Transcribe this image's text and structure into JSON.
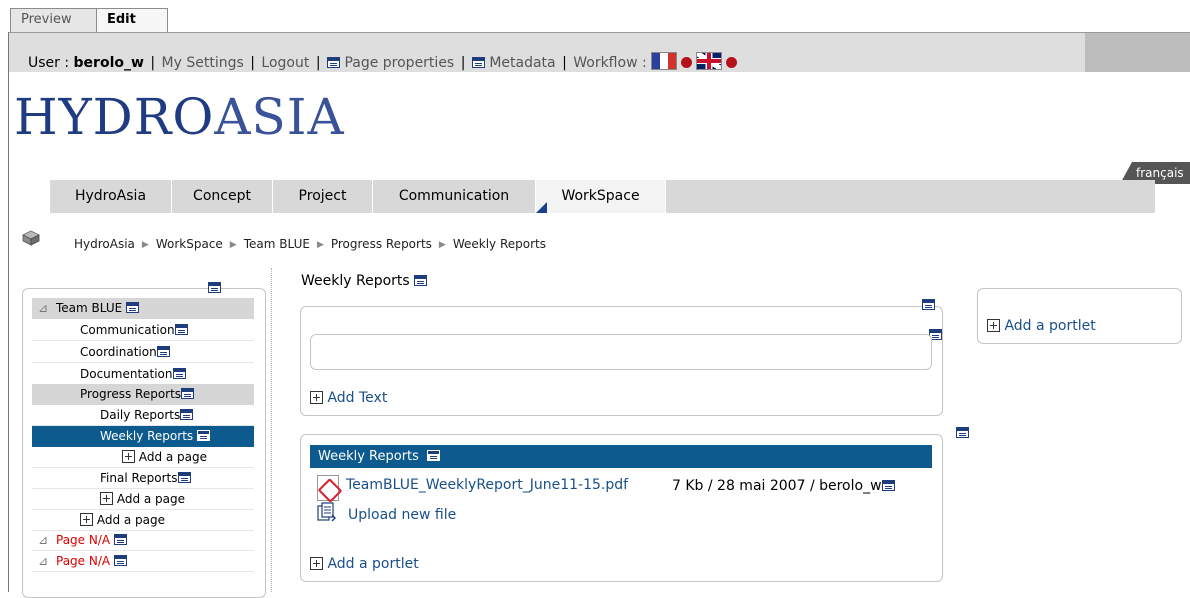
{
  "mode_tabs": {
    "preview": "Preview",
    "edit": "Edit"
  },
  "user_bar": {
    "user_label": "User :",
    "username": "berolo_w",
    "my_settings": "My Settings",
    "logout": "Logout",
    "page_properties": "Page properties",
    "metadata": "Metadata",
    "workflow": "Workflow :"
  },
  "logo": {
    "part1": "HYDRO",
    "part2": "ASIA"
  },
  "language_link": "français",
  "nav": {
    "tabs": [
      "HydroAsia",
      "Concept",
      "Project",
      "Communication",
      "WorkSpace"
    ],
    "active": "WorkSpace"
  },
  "breadcrumb": [
    "HydroAsia",
    "WorkSpace",
    "Team BLUE",
    "Progress Reports",
    "Weekly Reports"
  ],
  "tree": {
    "root": "Team BLUE",
    "communication": "Communication",
    "coordination": "Coordination",
    "documentation": "Documentation",
    "progress_reports": "Progress Reports",
    "daily_reports": "Daily Reports",
    "weekly_reports": "Weekly Reports",
    "add_page": "Add a page",
    "final_reports": "Final Reports",
    "page_na": "Page N/A"
  },
  "main": {
    "heading": "Weekly Reports",
    "add_text": "Add Text",
    "file_portlet": {
      "title": "Weekly Reports",
      "file_name": "TeamBLUE_WeeklyReport_June11-15.pdf",
      "file_meta": "7 Kb / 28 mai 2007 / berolo_w",
      "upload": "Upload new file"
    },
    "add_portlet": "Add a portlet"
  },
  "right": {
    "add_portlet": "Add a portlet"
  },
  "colors": {
    "accent": "#0d5b8e",
    "logo_blue": "#1f3b82",
    "page_na": "#e00000"
  },
  "icons": [
    "page-properties-icon",
    "plus-icon",
    "pdf-icon",
    "upload-icon",
    "flag-fr-icon",
    "flag-uk-icon",
    "status-dot-icon",
    "cube-icon"
  ]
}
